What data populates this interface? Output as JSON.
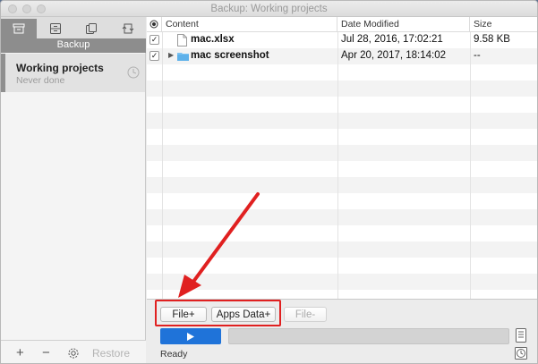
{
  "window": {
    "title": "Backup: Working projects"
  },
  "sidebar": {
    "mode_label": "Backup",
    "modes": [
      {
        "icon": "archive-icon",
        "active": true
      },
      {
        "icon": "drawer-icon",
        "active": false
      },
      {
        "icon": "copy-icon",
        "active": false
      },
      {
        "icon": "sync-icon",
        "active": false
      }
    ],
    "project": {
      "name": "Working projects",
      "status": "Never done"
    },
    "footer": {
      "add": "+",
      "remove": "−",
      "restore": "Restore"
    }
  },
  "table": {
    "columns": [
      "Content",
      "Date Modified",
      "Size"
    ],
    "rows": [
      {
        "checked": true,
        "type": "file",
        "name": "mac.xlsx",
        "date": "Jul 28, 2016, 17:02:21",
        "size": "9.58 KB"
      },
      {
        "checked": true,
        "type": "folder",
        "name": "mac screenshot",
        "date": "Apr 20, 2017, 18:14:02",
        "size": "--"
      }
    ]
  },
  "actions": {
    "file_plus": "File+",
    "apps_data_plus": "Apps Data+",
    "file_minus": "File-"
  },
  "status": {
    "text": "Ready",
    "progress": 0
  },
  "colors": {
    "accent": "#1f73d9",
    "annotation": "#e02020"
  }
}
